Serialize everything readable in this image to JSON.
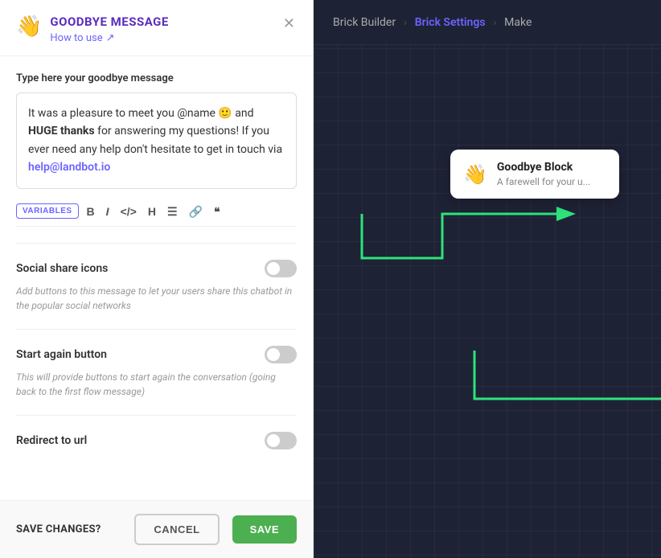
{
  "header": {
    "emoji": "👋",
    "title": "GOODBYE MESSAGE",
    "subtitle": "How to use",
    "subtitle_icon": "↗"
  },
  "editor": {
    "section_label": "Type here your goodbye message",
    "message_html": "It was a pleasure to meet you @name 🙂 and <strong>HUGE thanks</strong> for answering my questions! If you ever need any help don't hesitate to get in touch via <strong>help@landbot.io</strong>"
  },
  "toolbar": {
    "variables_label": "VARIABLES",
    "icons": [
      "B",
      "I",
      "</>",
      "H",
      "≡",
      "🔗",
      "❝"
    ]
  },
  "toggles": [
    {
      "id": "social-share",
      "title": "Social share icons",
      "description": "Add buttons to this message to let your users share this chatbot in the popular social networks",
      "enabled": false
    },
    {
      "id": "start-again",
      "title": "Start again button",
      "description": "This will provide buttons to start again the conversation (going back to the first flow message)",
      "enabled": false
    },
    {
      "id": "redirect-url",
      "title": "Redirect to url",
      "description": "",
      "enabled": false
    }
  ],
  "footer": {
    "label": "SAVE CHANGES?",
    "cancel": "CANCEL",
    "save": "SAVE"
  },
  "nav": {
    "items": [
      "Brick Builder",
      "Brick Settings",
      "Make"
    ],
    "active": "Brick Settings"
  },
  "canvas": {
    "card": {
      "emoji": "👋",
      "title": "Goodbye Block",
      "subtitle": "A farewell for your u..."
    }
  }
}
